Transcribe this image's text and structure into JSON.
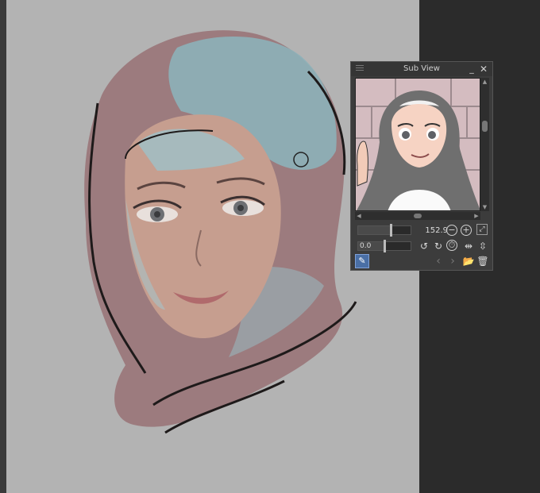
{
  "subview": {
    "title": "Sub View",
    "minimize_icon": "minimize-icon",
    "close_icon": "close-icon",
    "zoom_value": "152.9",
    "rotation_value": "0.0",
    "zoom_fraction": 0.62,
    "rotation_fraction": 0.5
  },
  "colors": {
    "canvas_bg": "#b3b3b3",
    "workspace_bg": "#2b2b2b",
    "panel_bg": "#3c3c3c",
    "accent": "#4a6fa5"
  }
}
